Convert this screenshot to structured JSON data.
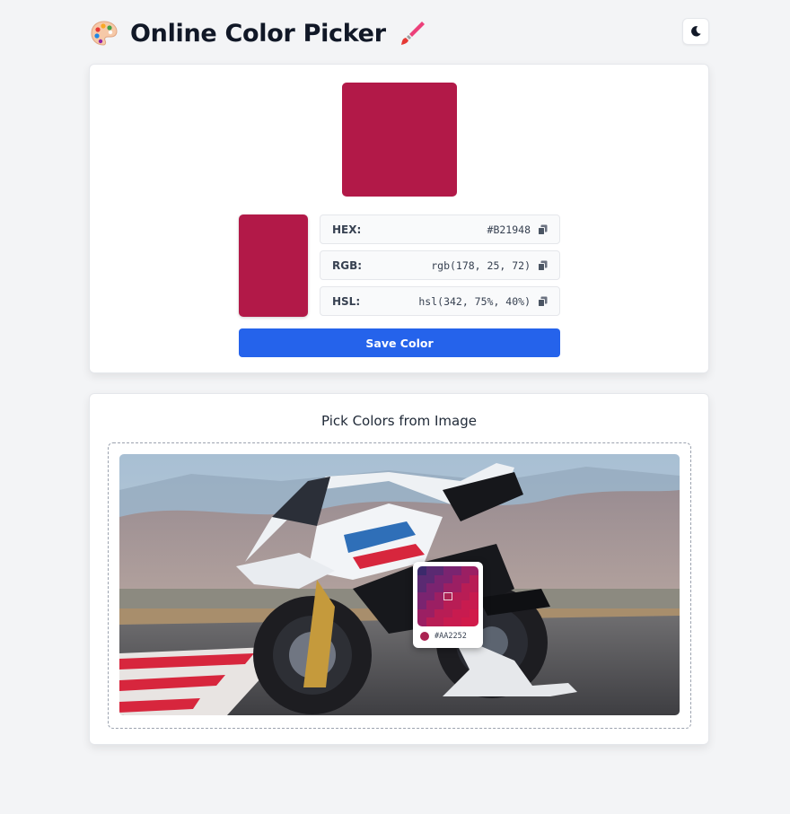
{
  "header": {
    "title": "Online Color Picker",
    "palette_icon": "artist-palette-icon",
    "brush_icon": "paintbrush-icon",
    "theme_toggle_icon": "moon-icon"
  },
  "picker": {
    "current_color": "#B21948",
    "rows": [
      {
        "label": "HEX:",
        "value": "#B21948"
      },
      {
        "label": "RGB:",
        "value": "rgb(178, 25, 72)"
      },
      {
        "label": "HSL:",
        "value": "hsl(342, 75%, 40%)"
      }
    ],
    "save_label": "Save Color"
  },
  "image_picker": {
    "title": "Pick Colors from Image",
    "hover_color": "#AA2252"
  },
  "colors": {
    "accent": "#2563eb",
    "page_bg": "#f3f4f6"
  }
}
